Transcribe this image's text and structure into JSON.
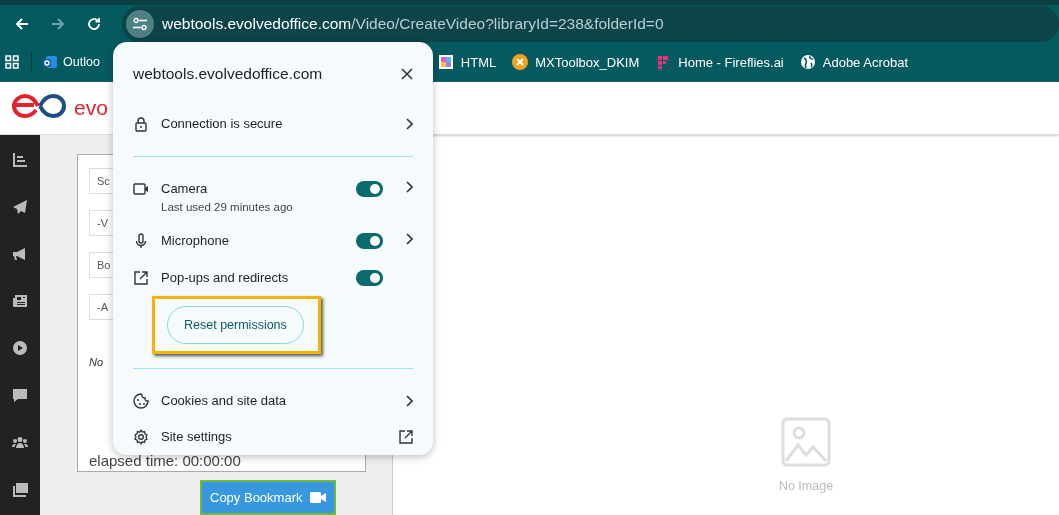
{
  "browser": {
    "nav_buttons": [
      {
        "kind": "back",
        "disabled": false
      },
      {
        "kind": "forward",
        "disabled": true
      },
      {
        "kind": "reload",
        "disabled": false
      }
    ],
    "address_bar": {
      "host": "webtools.evolvedoffice.com",
      "path": "/Video/CreateVideo?libraryId=238&folderId=0"
    },
    "bookmarks": [
      {
        "kind": "outlook",
        "label": "Outloo"
      },
      {
        "kind": "html",
        "label": "HTML"
      },
      {
        "kind": "mx",
        "label": "MXToolbox_DKIM"
      },
      {
        "kind": "fireflies",
        "label": "Home - Fireflies.ai"
      },
      {
        "kind": "globe",
        "label": "Adobe Acrobat"
      }
    ]
  },
  "app": {
    "logo_text": "evo",
    "form": {
      "fields": [
        "Sc",
        "-V",
        "Bo",
        "-A"
      ],
      "note": "No",
      "elapsed": "elapsed time: 00:00:00"
    },
    "copy_button": "Copy Bookmark",
    "preview": {
      "text": "No Image"
    }
  },
  "popup": {
    "title": "webtools.evolvedoffice.com",
    "connection": "Connection is secure",
    "permissions": [
      {
        "kind": "camera",
        "label": "Camera",
        "sub": "Last used 29 minutes ago",
        "on": true,
        "has_details": true
      },
      {
        "kind": "microphone",
        "label": "Microphone",
        "on": true,
        "has_details": true
      },
      {
        "kind": "popups",
        "label": "Pop-ups and redirects",
        "on": true,
        "has_details": false
      }
    ],
    "reset_button": "Reset permissions",
    "highlighted": true,
    "cookies": "Cookies and site data",
    "site_settings": "Site settings"
  }
}
